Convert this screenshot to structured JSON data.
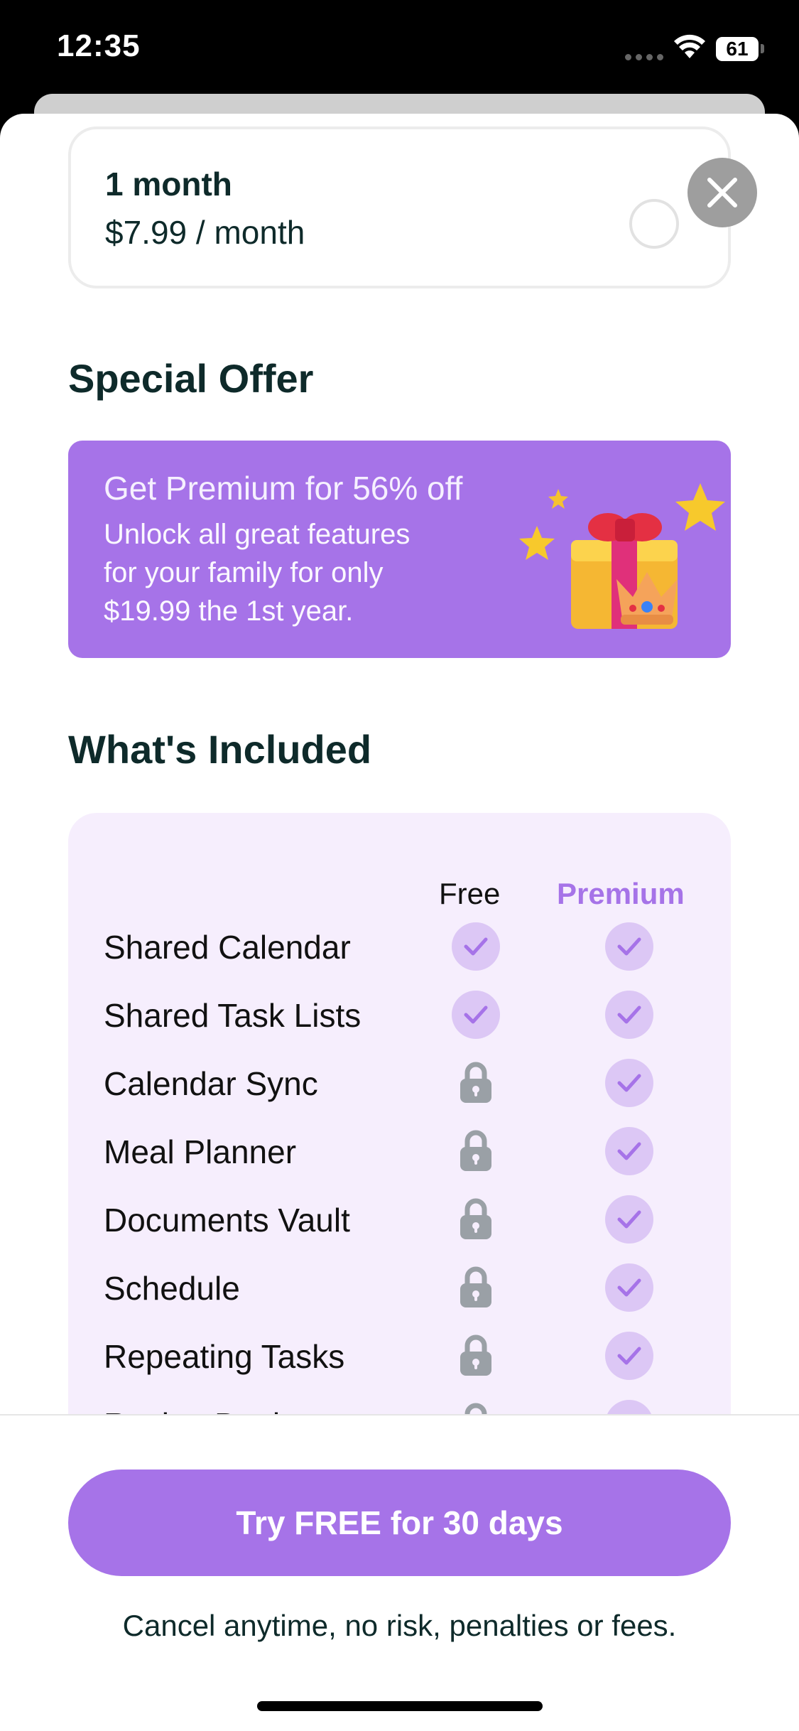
{
  "status_bar": {
    "time": "12:35",
    "battery": "61"
  },
  "plan": {
    "title": "1 month",
    "price": "$7.99 / month"
  },
  "special_offer": {
    "heading": "Special Offer",
    "title": "Get Premium for 56% off",
    "lines": [
      "Unlock all great features",
      "for your family for only",
      "$19.99 the 1st year."
    ]
  },
  "included": {
    "heading": "What's Included",
    "col_free": "Free",
    "col_premium": "Premium",
    "rows": [
      {
        "label": "Shared Calendar",
        "free": "check",
        "premium": "check"
      },
      {
        "label": "Shared Task Lists",
        "free": "check",
        "premium": "check"
      },
      {
        "label": "Calendar Sync",
        "free": "lock",
        "premium": "check"
      },
      {
        "label": "Meal Planner",
        "free": "lock",
        "premium": "check"
      },
      {
        "label": "Documents Vault",
        "free": "lock",
        "premium": "check"
      },
      {
        "label": "Schedule",
        "free": "lock",
        "premium": "check"
      },
      {
        "label": "Repeating Tasks",
        "free": "lock",
        "premium": "check"
      },
      {
        "label": "Recipe Book",
        "free": "lock",
        "premium": "check"
      }
    ]
  },
  "cta": {
    "label": "Try FREE for 30 days"
  },
  "footer_note": "Cancel anytime, no risk, penalties or fees.",
  "colors": {
    "accent": "#a673e8",
    "check_bg": "#dcc7f5",
    "table_bg": "#f6eefd",
    "text": "#0e2a2a"
  }
}
